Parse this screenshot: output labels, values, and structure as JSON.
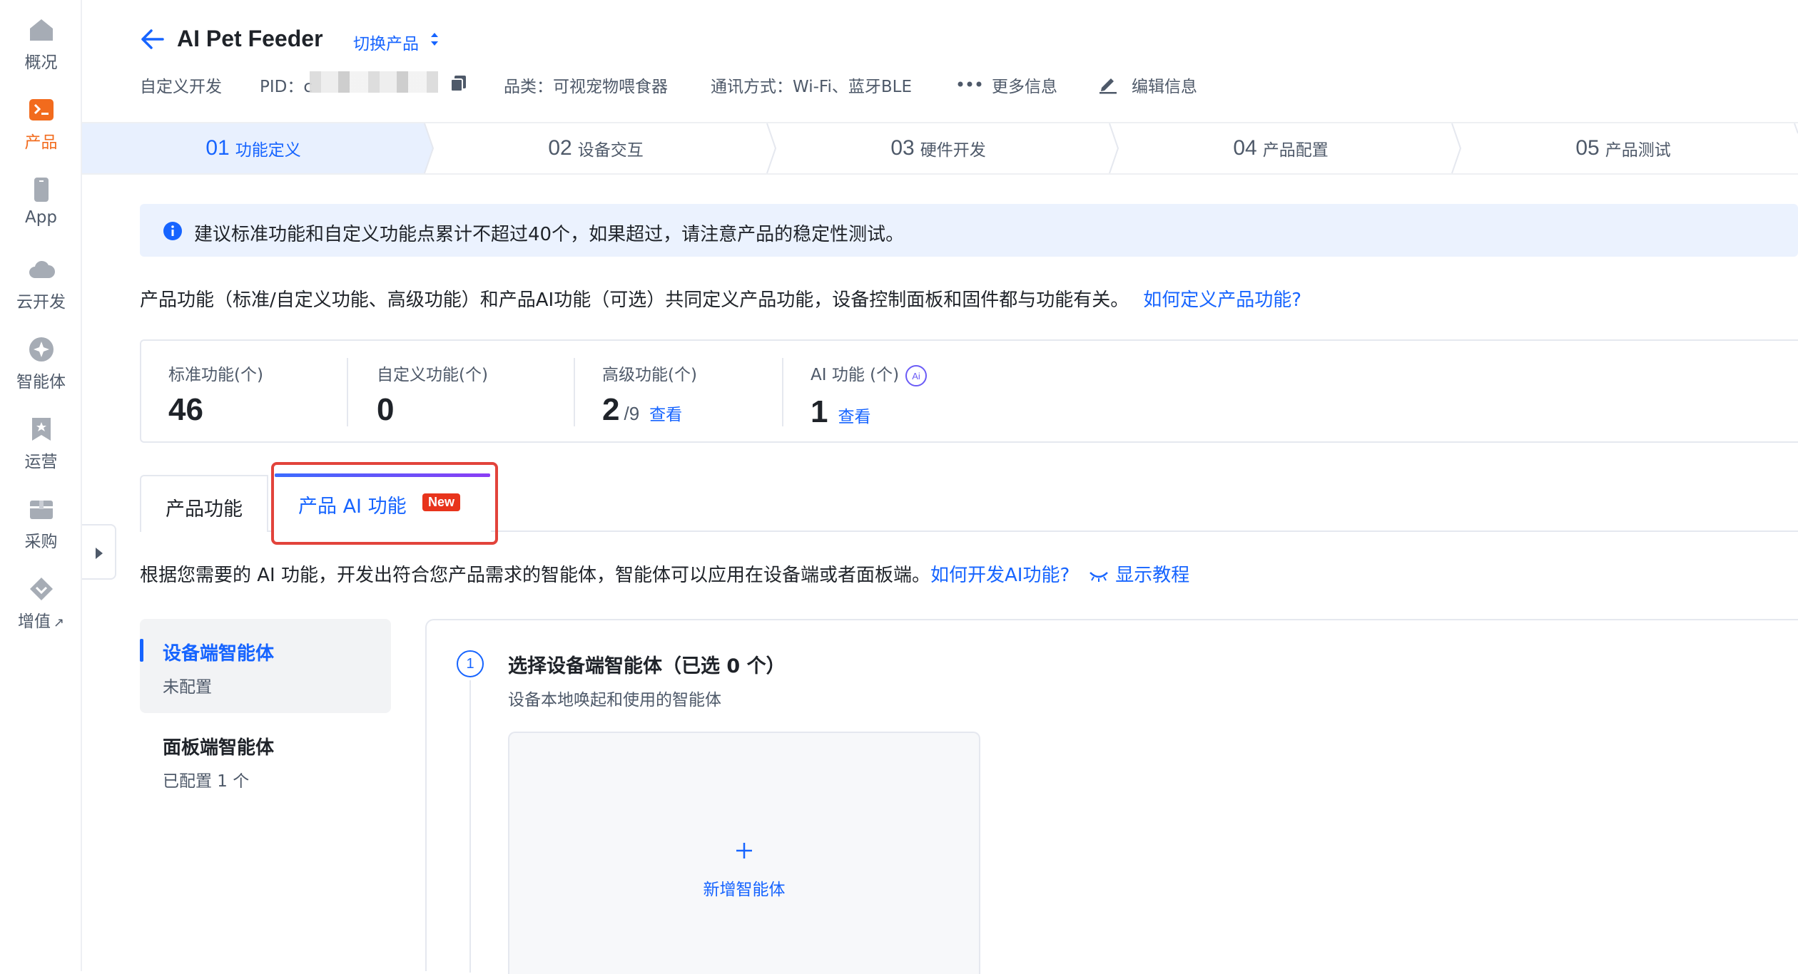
{
  "nav": {
    "items": [
      {
        "label": "概况",
        "icon": "home-icon"
      },
      {
        "label": "产品",
        "icon": "product-icon"
      },
      {
        "label": "App",
        "icon": "phone-icon"
      },
      {
        "label": "云开发",
        "icon": "cloud-icon"
      },
      {
        "label": "智能体",
        "icon": "sparkle-icon"
      },
      {
        "label": "运营",
        "icon": "bookmark-icon"
      },
      {
        "label": "采购",
        "icon": "box-icon"
      },
      {
        "label": "增值",
        "icon": "diamond-icon"
      }
    ],
    "external_mark": "↗",
    "active_color": "#f26b1d"
  },
  "header": {
    "title": "AI Pet Feeder",
    "switch_label": "切换产品",
    "dev_type": "自定义开发",
    "pid_label": "PID：",
    "pid_visible": "c",
    "category": "品类：可视宠物喂食器",
    "comm": "通讯方式：Wi-Fi、蓝牙BLE",
    "more_info": "更多信息",
    "edit_info": "编辑信息"
  },
  "steps": [
    {
      "num": "01",
      "name": "功能定义"
    },
    {
      "num": "02",
      "name": "设备交互"
    },
    {
      "num": "03",
      "name": "硬件开发"
    },
    {
      "num": "04",
      "name": "产品配置"
    },
    {
      "num": "05",
      "name": "产品测试"
    }
  ],
  "alert": {
    "text": "建议标准功能和自定义功能点累计不超过40个，如果超过，请注意产品的稳定性测试。"
  },
  "description": {
    "text": "产品功能（标准/自定义功能、高级功能）和产品AI功能（可选）共同定义产品功能，设备控制面板和固件都与功能有关。",
    "link": "如何定义产品功能?"
  },
  "stats": {
    "standard": {
      "label": "标准功能(个)",
      "value": "46"
    },
    "custom": {
      "label": "自定义功能(个)",
      "value": "0"
    },
    "advanced": {
      "label": "高级功能(个)",
      "value": "2",
      "total": "/9",
      "link": "查看"
    },
    "ai": {
      "label": "AI 功能 (个)",
      "value": "1",
      "link": "查看",
      "badge": "Ai"
    }
  },
  "tabs": {
    "product": "产品功能",
    "ai": "产品 AI 功能",
    "new_badge": "New"
  },
  "ai_section": {
    "desc": "根据您需要的 AI 功能，开发出符合您产品需求的智能体，智能体可以应用在设备端或者面板端。",
    "how_link": "如何开发AI功能?",
    "tutorial": "显示教程"
  },
  "agents": [
    {
      "title": "设备端智能体",
      "status": "未配置"
    },
    {
      "title": "面板端智能体",
      "status": "已配置 1 个"
    }
  ],
  "card": {
    "step": "1",
    "title": "选择设备端智能体（已选 0 个）",
    "subtitle": "设备本地唤起和使用的智能体",
    "add_label": "新增智能体"
  },
  "colors": {
    "primary": "#1664ff",
    "brand": "#f26b1d",
    "highlight": "#e2433b",
    "badge_red": "#e8341c"
  }
}
